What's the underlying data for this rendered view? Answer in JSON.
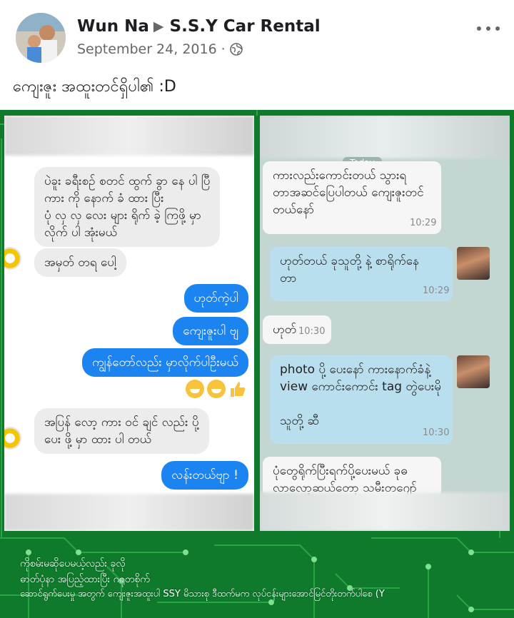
{
  "post": {
    "author": "Wun Na",
    "page": "S.S.Y Car Rental",
    "date": "September 24, 2016",
    "separator": "·",
    "caption": "ကျေးဇူး အထူးတင်ရှိပါ၏ :D"
  },
  "left_chat": [
    {
      "text": "ပဲခူး ခရီးစဉ် စတင် ထွက် ခွာ နေ ပါ ပြီ\nကား ကို နောက် ခံ ထား ပြီး\nပုံ လှ လှ လေး များ ရိုက် ခဲ့ ကြဖို့ မှာ\nလိုက် ပါ အုံးမယ်",
      "side": "in"
    },
    {
      "text": "အမှတ် တရ ပေါ့",
      "side": "in"
    },
    {
      "text": "ဟုတ်ကဲ့ပါ",
      "side": "out"
    },
    {
      "text": "ကျေးဇူးပါ ဗျ",
      "side": "out"
    },
    {
      "text": "ကျွန်တော်လည်း မှာလိုက်ပါဦးမယ်",
      "side": "out"
    },
    {
      "text": "အပြန် လော့ ကား ဝင် ချင် လည်း ပို့\nပေး ဖို့ မှာ ထား ပါ တယ်",
      "side": "in"
    },
    {
      "text": "လန်းတယ်ဗျာ !",
      "side": "out"
    }
  ],
  "right_chat": {
    "day_tag": "Today",
    "messages": [
      {
        "text": "ကားလည်းကောင်းတယ် သွားရ\nတာအဆင်ပြေပါတယ် ကျေးဇူးတင်\nတယ်နော်",
        "time": "10:29",
        "side": "in"
      },
      {
        "text": "ဟုတ်တယ် ခုသူတို့ နဲ့ စာရိုက်နေ\nတာ",
        "time": "10:29",
        "side": "out"
      },
      {
        "text": "ဟုတ်",
        "time": "10:30",
        "side": "in"
      },
      {
        "text": "photo ပို့ ပေးနော် ကားနောက်ခံနဲ့\nview ကောင်းကောင်း tag တွဲပေးမို\n\nသူတို့ ဆီ",
        "time": "10:30",
        "side": "out"
      },
      {
        "text": "ပုံတွေရိုက်ပြီးရက်ပို့ပေးမယ် ခုဓ\nလာလော့ဆယ်တော့ သမီးတဂျော်",
        "time": "",
        "side": "in"
      }
    ]
  },
  "photo_footer": [
    "ကိုစမ်းမဆိုပေမယ့်လည်း ခုလို",
    "ဓာတ်ပုံနာ အပြည့်ထားပြီး ဂရုတစိုက်",
    "ဆောင်ရွက်ပေးမှု အတွက် ကျေးဇူးအထူးပါ SSY မိသားစု ဒီထက်မက လုပ်ငန်းများအောင်မြင်တိုးတက်ပါစေ (Y"
  ],
  "colors": {
    "messenger_blue": "#1c84f1",
    "circuit_green": "#0f7a2c",
    "viber_out": "#b9dfef",
    "meta_gray": "#65676b"
  },
  "icons": [
    "globe-icon",
    "more-icon",
    "play-arrow-icon"
  ]
}
